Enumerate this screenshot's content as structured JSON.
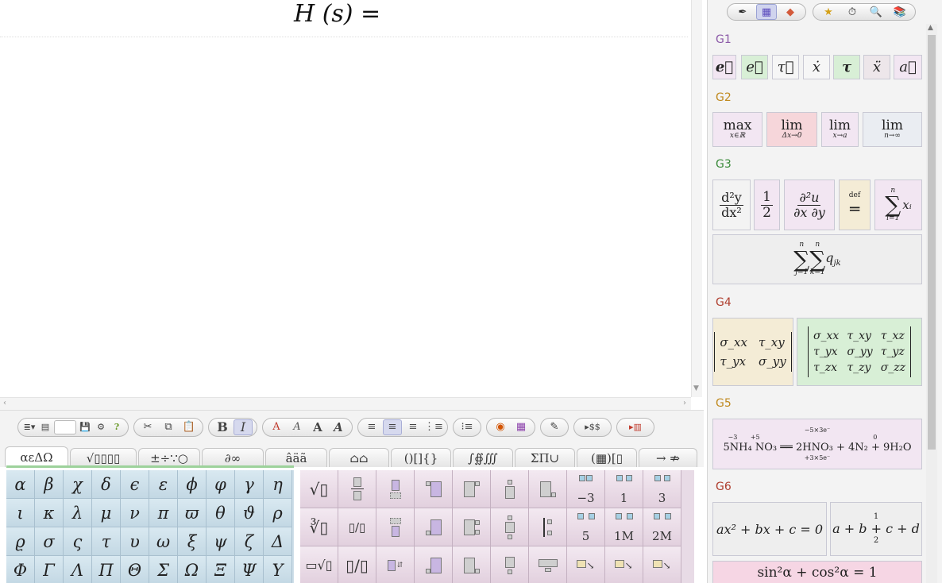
{
  "editor": {
    "formula": "H (s) ="
  },
  "toolbar": {
    "groups": [
      [
        "≣▾",
        "▤",
        "",
        "💾",
        "⚙",
        "?"
      ],
      [
        "✂",
        "⧉",
        "📋"
      ],
      [
        "B",
        "I"
      ],
      [
        "A",
        "A",
        "A",
        "A"
      ],
      [
        "≡",
        "≡",
        "≡",
        "⋮≡"
      ],
      [
        "⁝≡"
      ],
      [
        "◉",
        "▦"
      ],
      [
        "✎"
      ],
      [
        "▸$$"
      ],
      [
        "▸▥"
      ]
    ]
  },
  "tabs": [
    "αεΔΩ",
    "√▯▯▯▯",
    "±÷∵○",
    "∂∞",
    "âäã",
    "⌂⌂",
    "()[]{}",
    "∫∯∭",
    "ΣΠ∪",
    "(▦)[▯",
    "→ ⇏"
  ],
  "greek": [
    [
      "α",
      "β",
      "χ",
      "δ",
      "ϵ",
      "ε",
      "ϕ",
      "φ",
      "γ",
      "η"
    ],
    [
      "ι",
      "κ",
      "λ",
      "μ",
      "ν",
      "π",
      "ϖ",
      "θ",
      "ϑ",
      "ρ"
    ],
    [
      "ϱ",
      "σ",
      "ς",
      "τ",
      "υ",
      "ω",
      "ξ",
      "ψ",
      "ζ",
      "Δ"
    ],
    [
      "Φ",
      "Γ",
      "Λ",
      "Π",
      "Θ",
      "Σ",
      "Ω",
      "Ξ",
      "Ψ",
      "Υ"
    ]
  ],
  "templates": {
    "row1": [
      "√▯",
      "",
      "",
      "",
      "",
      "",
      "",
      "−3",
      "1",
      "3"
    ],
    "row2": [
      "∛▯",
      "▯/▯",
      "",
      "",
      "",
      "",
      "",
      "5",
      "1M",
      "2M"
    ],
    "row3": [
      "",
      "",
      "",
      "",
      "",
      "",
      "",
      "",
      "",
      ""
    ]
  },
  "right": {
    "top_icons": [
      "✒",
      "▦",
      "◆",
      "★",
      "⏱",
      "🔍",
      "📚"
    ],
    "groups": [
      {
        "title": "G1",
        "color": "#8c5aa8"
      },
      {
        "title": "G2",
        "color": "#c08a20"
      },
      {
        "title": "G3",
        "color": "#3a8a3a"
      },
      {
        "title": "G4",
        "color": "#b04030"
      },
      {
        "title": "G5",
        "color": "#c08a20"
      },
      {
        "title": "G6",
        "color": "#b04030"
      }
    ],
    "g1": [
      "e⃗",
      "e⃗",
      "τ⃗",
      "ẋ",
      "τ",
      "ẍ",
      "a⃗"
    ],
    "g2": [
      {
        "main": "max",
        "sub": "x∈ℝ"
      },
      {
        "main": "lim",
        "sub": "Δx→0"
      },
      {
        "main": "lim",
        "sub": "x→a"
      },
      {
        "main": "lim",
        "sub": "n→∞"
      }
    ],
    "g3": {
      "d2y_num": "d²y",
      "d2y_den": "dx²",
      "half_num": "1",
      "half_den": "2",
      "pd_num": "∂²u",
      "pd_den": "∂x ∂y",
      "def_top": "def",
      "def_eq": "═",
      "sum_top": "n",
      "sum_sym": "∑",
      "sum_bot": "i=1",
      "sum_term": "xᵢ",
      "dsum": "∑ ∑ q",
      "dsum_sub": "jk",
      "dsum_top1": "n",
      "dsum_top2": "n",
      "dsum_bot1": "j=1",
      "dsum_bot2": "k=1"
    },
    "g4": {
      "m2": [
        [
          "σ_xx",
          "τ_xy"
        ],
        [
          "τ_yx",
          "σ_yy"
        ]
      ],
      "m3": [
        [
          "σ_xx",
          "τ_xy",
          "τ_xz"
        ],
        [
          "τ_yx",
          "σ_yy",
          "τ_yz"
        ],
        [
          "τ_zx",
          "τ_zy",
          "σ_zz"
        ]
      ]
    },
    "g5": {
      "top": "−5×3e⁻",
      "ox1": "−3",
      "ox2": "+5",
      "ox3": "0",
      "eq": "5NH₄ NO₃ ══ 2HNO₃ + 4N₂ + 9H₂O",
      "bottom": "+3×5e⁻"
    },
    "g6": {
      "quad": "ax² + bx + c = 0",
      "brace_top": "1",
      "brace_eq": "a + b + c + d",
      "brace_bot": "2",
      "trig": "sin²α + cos²α = 1"
    }
  }
}
